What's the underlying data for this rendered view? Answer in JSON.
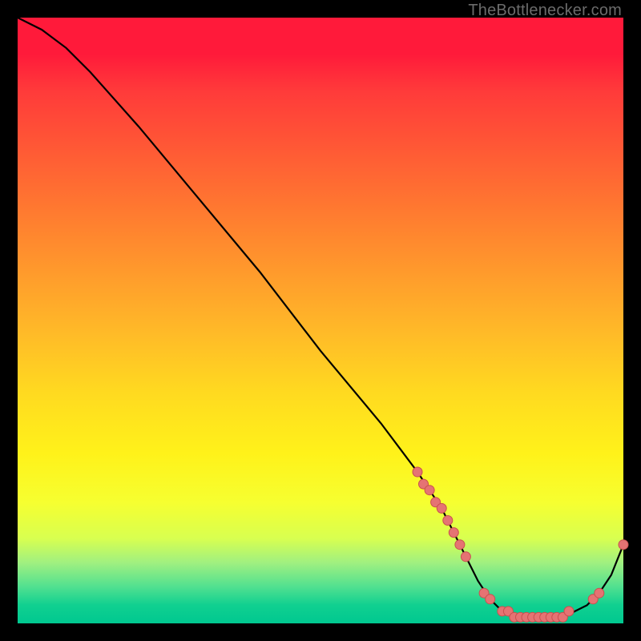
{
  "attribution": "TheBottlenecker.com",
  "colors": {
    "curve": "#000000",
    "marker_fill": "#e57373",
    "marker_stroke": "#c94f4f"
  },
  "chart_data": {
    "type": "line",
    "title": "",
    "xlabel": "",
    "ylabel": "",
    "xlim": [
      0,
      100
    ],
    "ylim": [
      0,
      100
    ],
    "series": [
      {
        "name": "curve",
        "x": [
          0,
          4,
          8,
          12,
          20,
          30,
          40,
          50,
          60,
          66,
          68,
          70,
          72,
          73,
          74,
          76,
          78,
          80,
          82,
          83,
          84,
          86,
          88,
          90,
          92,
          94,
          96,
          98,
          100
        ],
        "y": [
          100,
          98,
          95,
          91,
          82,
          70,
          58,
          45,
          33,
          25,
          22,
          19,
          15,
          13,
          11,
          7,
          4,
          2,
          1,
          1,
          1,
          1,
          1,
          1,
          2,
          3,
          5,
          8,
          13
        ]
      }
    ],
    "markers": [
      {
        "x": 66,
        "y": 25
      },
      {
        "x": 67,
        "y": 23
      },
      {
        "x": 68,
        "y": 22
      },
      {
        "x": 69,
        "y": 20
      },
      {
        "x": 70,
        "y": 19
      },
      {
        "x": 71,
        "y": 17
      },
      {
        "x": 72,
        "y": 15
      },
      {
        "x": 73,
        "y": 13
      },
      {
        "x": 74,
        "y": 11
      },
      {
        "x": 77,
        "y": 5
      },
      {
        "x": 78,
        "y": 4
      },
      {
        "x": 80,
        "y": 2
      },
      {
        "x": 81,
        "y": 2
      },
      {
        "x": 82,
        "y": 1
      },
      {
        "x": 83,
        "y": 1
      },
      {
        "x": 84,
        "y": 1
      },
      {
        "x": 85,
        "y": 1
      },
      {
        "x": 86,
        "y": 1
      },
      {
        "x": 87,
        "y": 1
      },
      {
        "x": 88,
        "y": 1
      },
      {
        "x": 89,
        "y": 1
      },
      {
        "x": 90,
        "y": 1
      },
      {
        "x": 91,
        "y": 2
      },
      {
        "x": 95,
        "y": 4
      },
      {
        "x": 96,
        "y": 5
      },
      {
        "x": 100,
        "y": 13
      }
    ]
  }
}
